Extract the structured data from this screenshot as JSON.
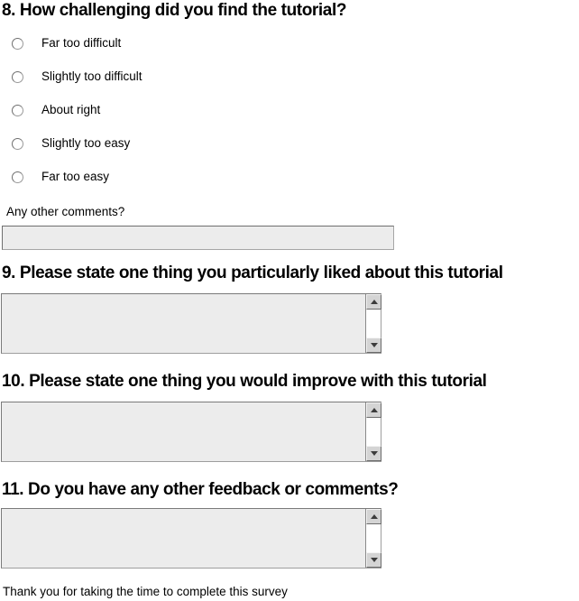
{
  "questions": {
    "q8": {
      "heading": "8. How challenging did you find the tutorial?",
      "options": [
        "Far too difficult",
        "Slightly too difficult",
        "About right",
        "Slightly too easy",
        "Far too easy"
      ],
      "comments_label": "Any other comments?",
      "comments_value": "",
      "comments_placeholder": ""
    },
    "q9": {
      "heading": "9. Please state one thing you particularly liked about this tutorial",
      "value": "",
      "placeholder": ""
    },
    "q10": {
      "heading": "10. Please state one thing you would improve with this tutorial",
      "value": "",
      "placeholder": ""
    },
    "q11": {
      "heading": "11. Do you have any other feedback or comments?",
      "value": "",
      "placeholder": ""
    }
  },
  "footer": {
    "thank_you": "Thank you for taking the time to complete this survey"
  },
  "icons": {
    "scroll_up": "scroll-up-arrow-icon",
    "scroll_down": "scroll-down-arrow-icon",
    "radio": "radio-button-icon"
  },
  "colors": {
    "field_background": "#ececec",
    "field_border": "#6f6f6f",
    "scrollbar_button": "#d4d4d4",
    "scrollbar_track": "#ffffff",
    "text": "#000000",
    "page_background": "#ffffff"
  }
}
